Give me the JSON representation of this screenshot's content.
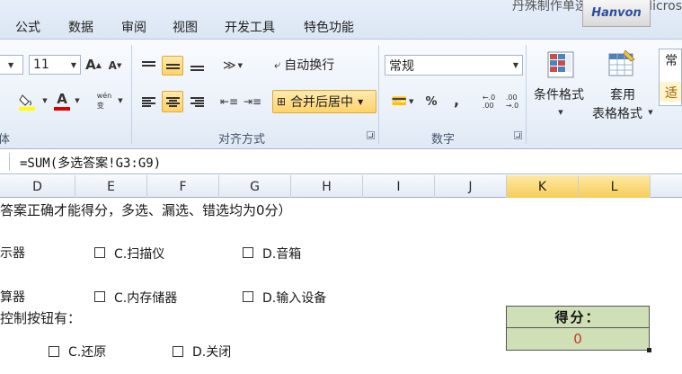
{
  "window": {
    "title": "丹殊制作单选题.xlsx - Micros",
    "addon_label": "Hanvon"
  },
  "menu": {
    "items": [
      "公式",
      "数据",
      "审阅",
      "视图",
      "开发工具",
      "特色功能"
    ]
  },
  "ribbon": {
    "font": {
      "size": "11",
      "grow_label": "A",
      "shrink_label": "A",
      "font_color_label": "A",
      "phonetic_label": "wén\n变",
      "group_partial": "体"
    },
    "alignment": {
      "wrap_text": "自动换行",
      "merge_center": "合并后居中",
      "group_label": "对齐方式"
    },
    "number": {
      "format": "常规",
      "percent": "%",
      "comma": ",",
      "group_label": "数字"
    },
    "styles": {
      "conditional_format": "条件格式",
      "table_format_line1": "套用",
      "table_format_line2": "表格格式",
      "gallery_item1": "常",
      "gallery_item2": "适"
    }
  },
  "formula_bar": {
    "formula": "=SUM(多选答案!G3:G9)"
  },
  "columns": [
    "D",
    "E",
    "F",
    "G",
    "H",
    "I",
    "J",
    "K",
    "L"
  ],
  "selected_columns": [
    "K",
    "L"
  ],
  "sheet": {
    "instruction": "答案正确才能得分，多选、漏选、错选均为0分）",
    "row1_partial": "示器",
    "row1_options": [
      "C.扫描仪",
      "D.音箱"
    ],
    "row2_partial": "算器",
    "row2_options": [
      "C.内存储器",
      "D.输入设备"
    ],
    "row3_partial": "控制按钮有：",
    "row4_options": [
      "C.还原",
      "D.关闭"
    ],
    "score_label": "得分：",
    "score_value": "0"
  },
  "colors": {
    "selected_header": "#f7cd58",
    "score_bg": "#cfe0b6",
    "score_value": "#c0392b",
    "active_button": "#ffd36a"
  }
}
